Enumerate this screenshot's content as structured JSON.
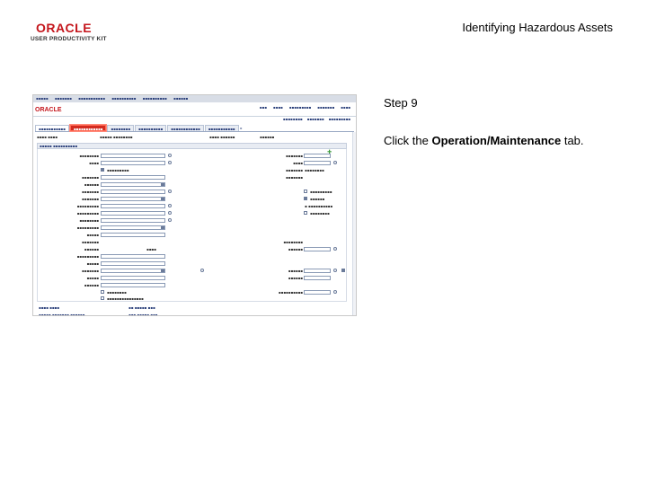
{
  "header": {
    "logo_text": "ORACLE",
    "logo_subtext": "USER PRODUCTIVITY KIT",
    "title": "Identifying Hazardous Assets"
  },
  "step": {
    "number_label": "Step 9",
    "instruction_prefix": "Click the ",
    "instruction_target": "Operation/Maintenance",
    "instruction_suffix": " tab."
  },
  "colors": {
    "highlight_tab": "#d22a1f",
    "oracle_red": "#c4161c",
    "link_blue": "#2a3f7a"
  }
}
